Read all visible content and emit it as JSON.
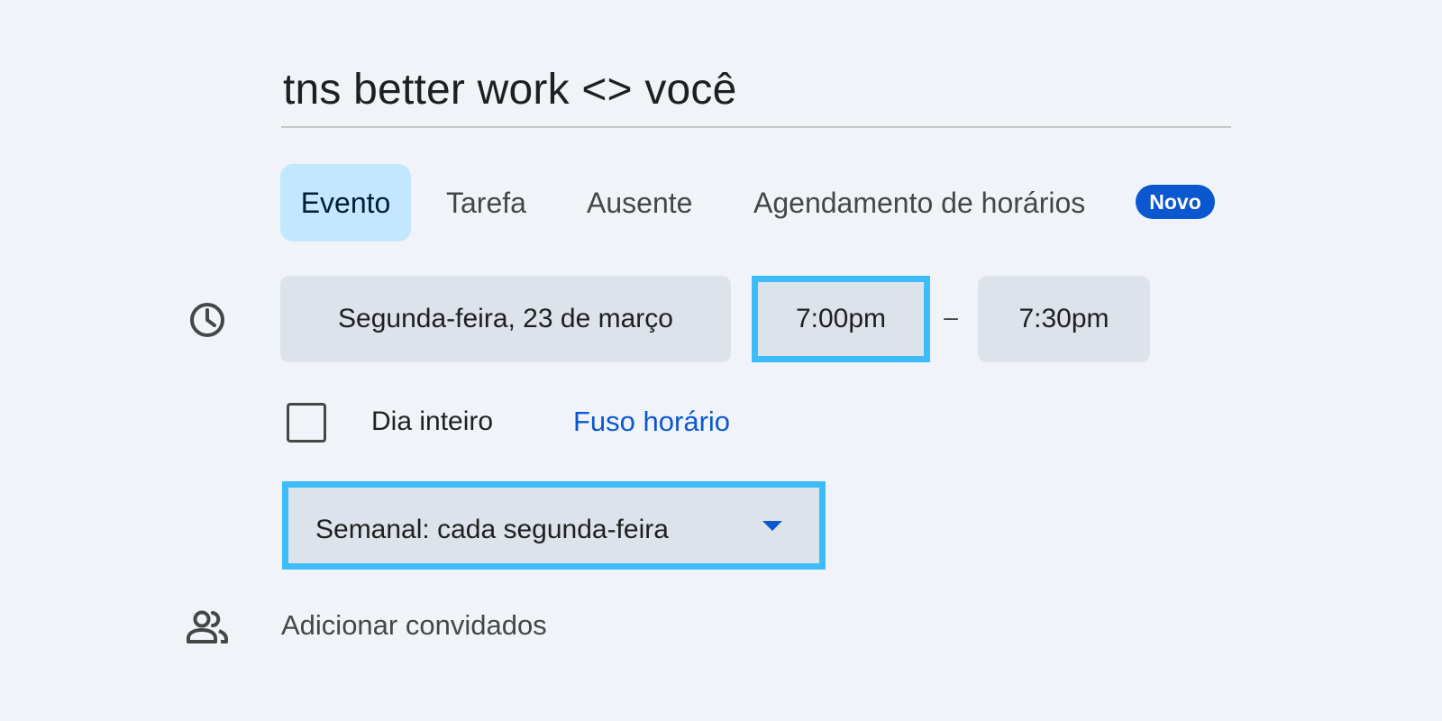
{
  "event": {
    "title": "tns better work <> você"
  },
  "tabs": [
    {
      "label": "Evento",
      "active": true
    },
    {
      "label": "Tarefa",
      "active": false
    },
    {
      "label": "Ausente",
      "active": false
    },
    {
      "label": "Agendamento de horários",
      "active": false,
      "badge": "Novo"
    }
  ],
  "datetime": {
    "icon": "clock-icon",
    "date": "Segunda-feira, 23 de março",
    "start_time": "7:00pm",
    "separator": "–",
    "end_time": "7:30pm"
  },
  "options": {
    "all_day_label": "Dia inteiro",
    "all_day_checked": false,
    "timezone_link": "Fuso horário"
  },
  "recurrence": {
    "value": "Semanal: cada segunda-feira",
    "icon": "caret-down-icon"
  },
  "guests": {
    "icon": "people-icon",
    "placeholder": "Adicionar convidados"
  },
  "colors": {
    "background": "#f0f4f9",
    "active_tab": "#c2e7ff",
    "accent_blue": "#0b57d0",
    "pill": "#dde3ea",
    "highlight": "#3ebcfa"
  }
}
